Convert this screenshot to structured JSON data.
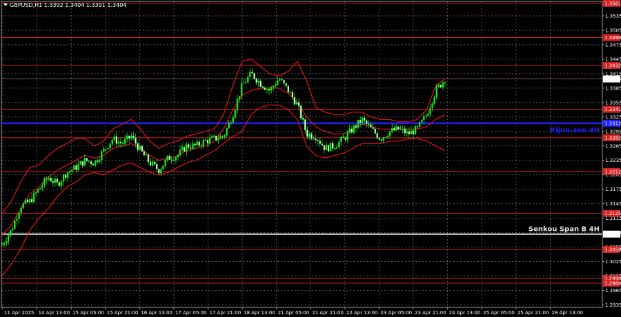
{
  "chart_data": {
    "type": "line",
    "title": "GBPUSD,H1  1.3392 1.3404 1.3391 1.3404",
    "symbol_icon": "triangle-down-icon",
    "ylim": [
      1.293,
      1.3565
    ],
    "y_ticks": [
      "1.3535",
      "1.3505",
      "1.3475",
      "1.3445",
      "1.3415",
      "1.3385",
      "1.3355",
      "1.3325",
      "1.3295",
      "1.3265",
      "1.3235",
      "1.3205",
      "1.3175",
      "1.3145",
      "1.3115",
      "1.3085",
      "1.3055",
      "1.3025",
      "1.2995",
      "1.2965",
      "1.2935"
    ],
    "x_ticks": [
      "11 Apr 2025",
      "14 Apr 13:00",
      "15 Apr 05:00",
      "15 Apr 21:00",
      "16 Apr 13:00",
      "17 Apr 05:00",
      "17 Apr 21:00",
      "18 Apr 13:00",
      "21 Apr 05:00",
      "21 Apr 21:00",
      "22 Apr 13:00",
      "23 Apr 05:00",
      "23 Apr 21:00",
      "24 Apr 13:00",
      "25 Apr 05:00",
      "25 Apr 21:00",
      "28 Apr 13:00"
    ],
    "levels": [
      {
        "value": 1.3561,
        "tag": "1.3561",
        "color": "#d42020"
      },
      {
        "value": 1.349,
        "tag": "1.3490",
        "color": "#d42020"
      },
      {
        "value": 1.3432,
        "tag": "1.3432",
        "color": "#d42020"
      },
      {
        "value": 1.3341,
        "tag": "1.3341",
        "color": "#d42020"
      },
      {
        "value": 1.3282,
        "tag": "1.3282",
        "color": "#d42020"
      },
      {
        "value": 1.3212,
        "tag": "1.3212",
        "color": "#d42020"
      },
      {
        "value": 1.3125,
        "tag": "1.3125",
        "color": "#d42020"
      },
      {
        "value": 1.305,
        "tag": "1.3050",
        "color": "#d42020"
      },
      {
        "value": 1.299,
        "tag": "1.2990",
        "color": "#d42020"
      },
      {
        "value": 1.298,
        "tag": "1.2980",
        "color": "#d42020"
      }
    ],
    "kijun": {
      "name": "Kijun-sen 4H",
      "value": 1.3312,
      "tag": "1.3312",
      "color": "#1d20ff"
    },
    "senkou": {
      "name": "Senkou Span B 4H",
      "value": 1.3082,
      "tag": "1.3082",
      "color": "#e0e0e0"
    },
    "current_price": {
      "value": 1.3404,
      "tag": "1.3404"
    },
    "price_path": [
      1.306,
      1.309,
      1.314,
      1.315,
      1.3175,
      1.32,
      1.3185,
      1.321,
      1.322,
      1.3235,
      1.323,
      1.3255,
      1.328,
      1.327,
      1.3285,
      1.3255,
      1.323,
      1.3215,
      1.324,
      1.3245,
      1.3265,
      1.3265,
      1.3275,
      1.328,
      1.3285,
      1.333,
      1.339,
      1.3415,
      1.3395,
      1.338,
      1.3405,
      1.338,
      1.335,
      1.329,
      1.3285,
      1.326,
      1.3265,
      1.328,
      1.33,
      1.332,
      1.33,
      1.328,
      1.3295,
      1.33,
      1.329,
      1.33,
      1.333,
      1.338,
      1.3404
    ],
    "bands": {
      "upper": [
        1.3125,
        1.315,
        1.319,
        1.322,
        1.3225,
        1.3245,
        1.326,
        1.327,
        1.328,
        1.328,
        1.3265,
        1.3275,
        1.33,
        1.331,
        1.332,
        1.33,
        1.3275,
        1.326,
        1.327,
        1.3275,
        1.3285,
        1.329,
        1.3295,
        1.33,
        1.333,
        1.339,
        1.344,
        1.3445,
        1.343,
        1.3415,
        1.341,
        1.342,
        1.344,
        1.34,
        1.3345,
        1.3335,
        1.333,
        1.333,
        1.3335,
        1.3335,
        1.3325,
        1.332,
        1.332,
        1.3315,
        1.3315,
        1.332,
        1.334,
        1.339,
        1.3404
      ],
      "middle": [
        1.308,
        1.31,
        1.3135,
        1.3165,
        1.318,
        1.32,
        1.3215,
        1.3225,
        1.3235,
        1.3245,
        1.324,
        1.3245,
        1.326,
        1.3265,
        1.327,
        1.326,
        1.3245,
        1.3235,
        1.324,
        1.3245,
        1.3255,
        1.326,
        1.3265,
        1.3275,
        1.33,
        1.334,
        1.337,
        1.338,
        1.3385,
        1.3385,
        1.3385,
        1.3375,
        1.3355,
        1.3325,
        1.3305,
        1.3295,
        1.329,
        1.329,
        1.33,
        1.331,
        1.3305,
        1.33,
        1.33,
        1.33,
        1.33,
        1.33,
        1.3305,
        1.332,
        1.333
      ],
      "lower": [
        1.2995,
        1.302,
        1.305,
        1.309,
        1.3115,
        1.3135,
        1.316,
        1.318,
        1.319,
        1.3205,
        1.321,
        1.3205,
        1.3215,
        1.3225,
        1.323,
        1.322,
        1.321,
        1.3205,
        1.321,
        1.322,
        1.323,
        1.3235,
        1.3245,
        1.3255,
        1.327,
        1.3285,
        1.3295,
        1.333,
        1.3345,
        1.335,
        1.335,
        1.334,
        1.332,
        1.3265,
        1.3245,
        1.324,
        1.3245,
        1.325,
        1.326,
        1.327,
        1.327,
        1.327,
        1.3275,
        1.3275,
        1.328,
        1.328,
        1.3275,
        1.3265,
        1.3255
      ]
    }
  }
}
